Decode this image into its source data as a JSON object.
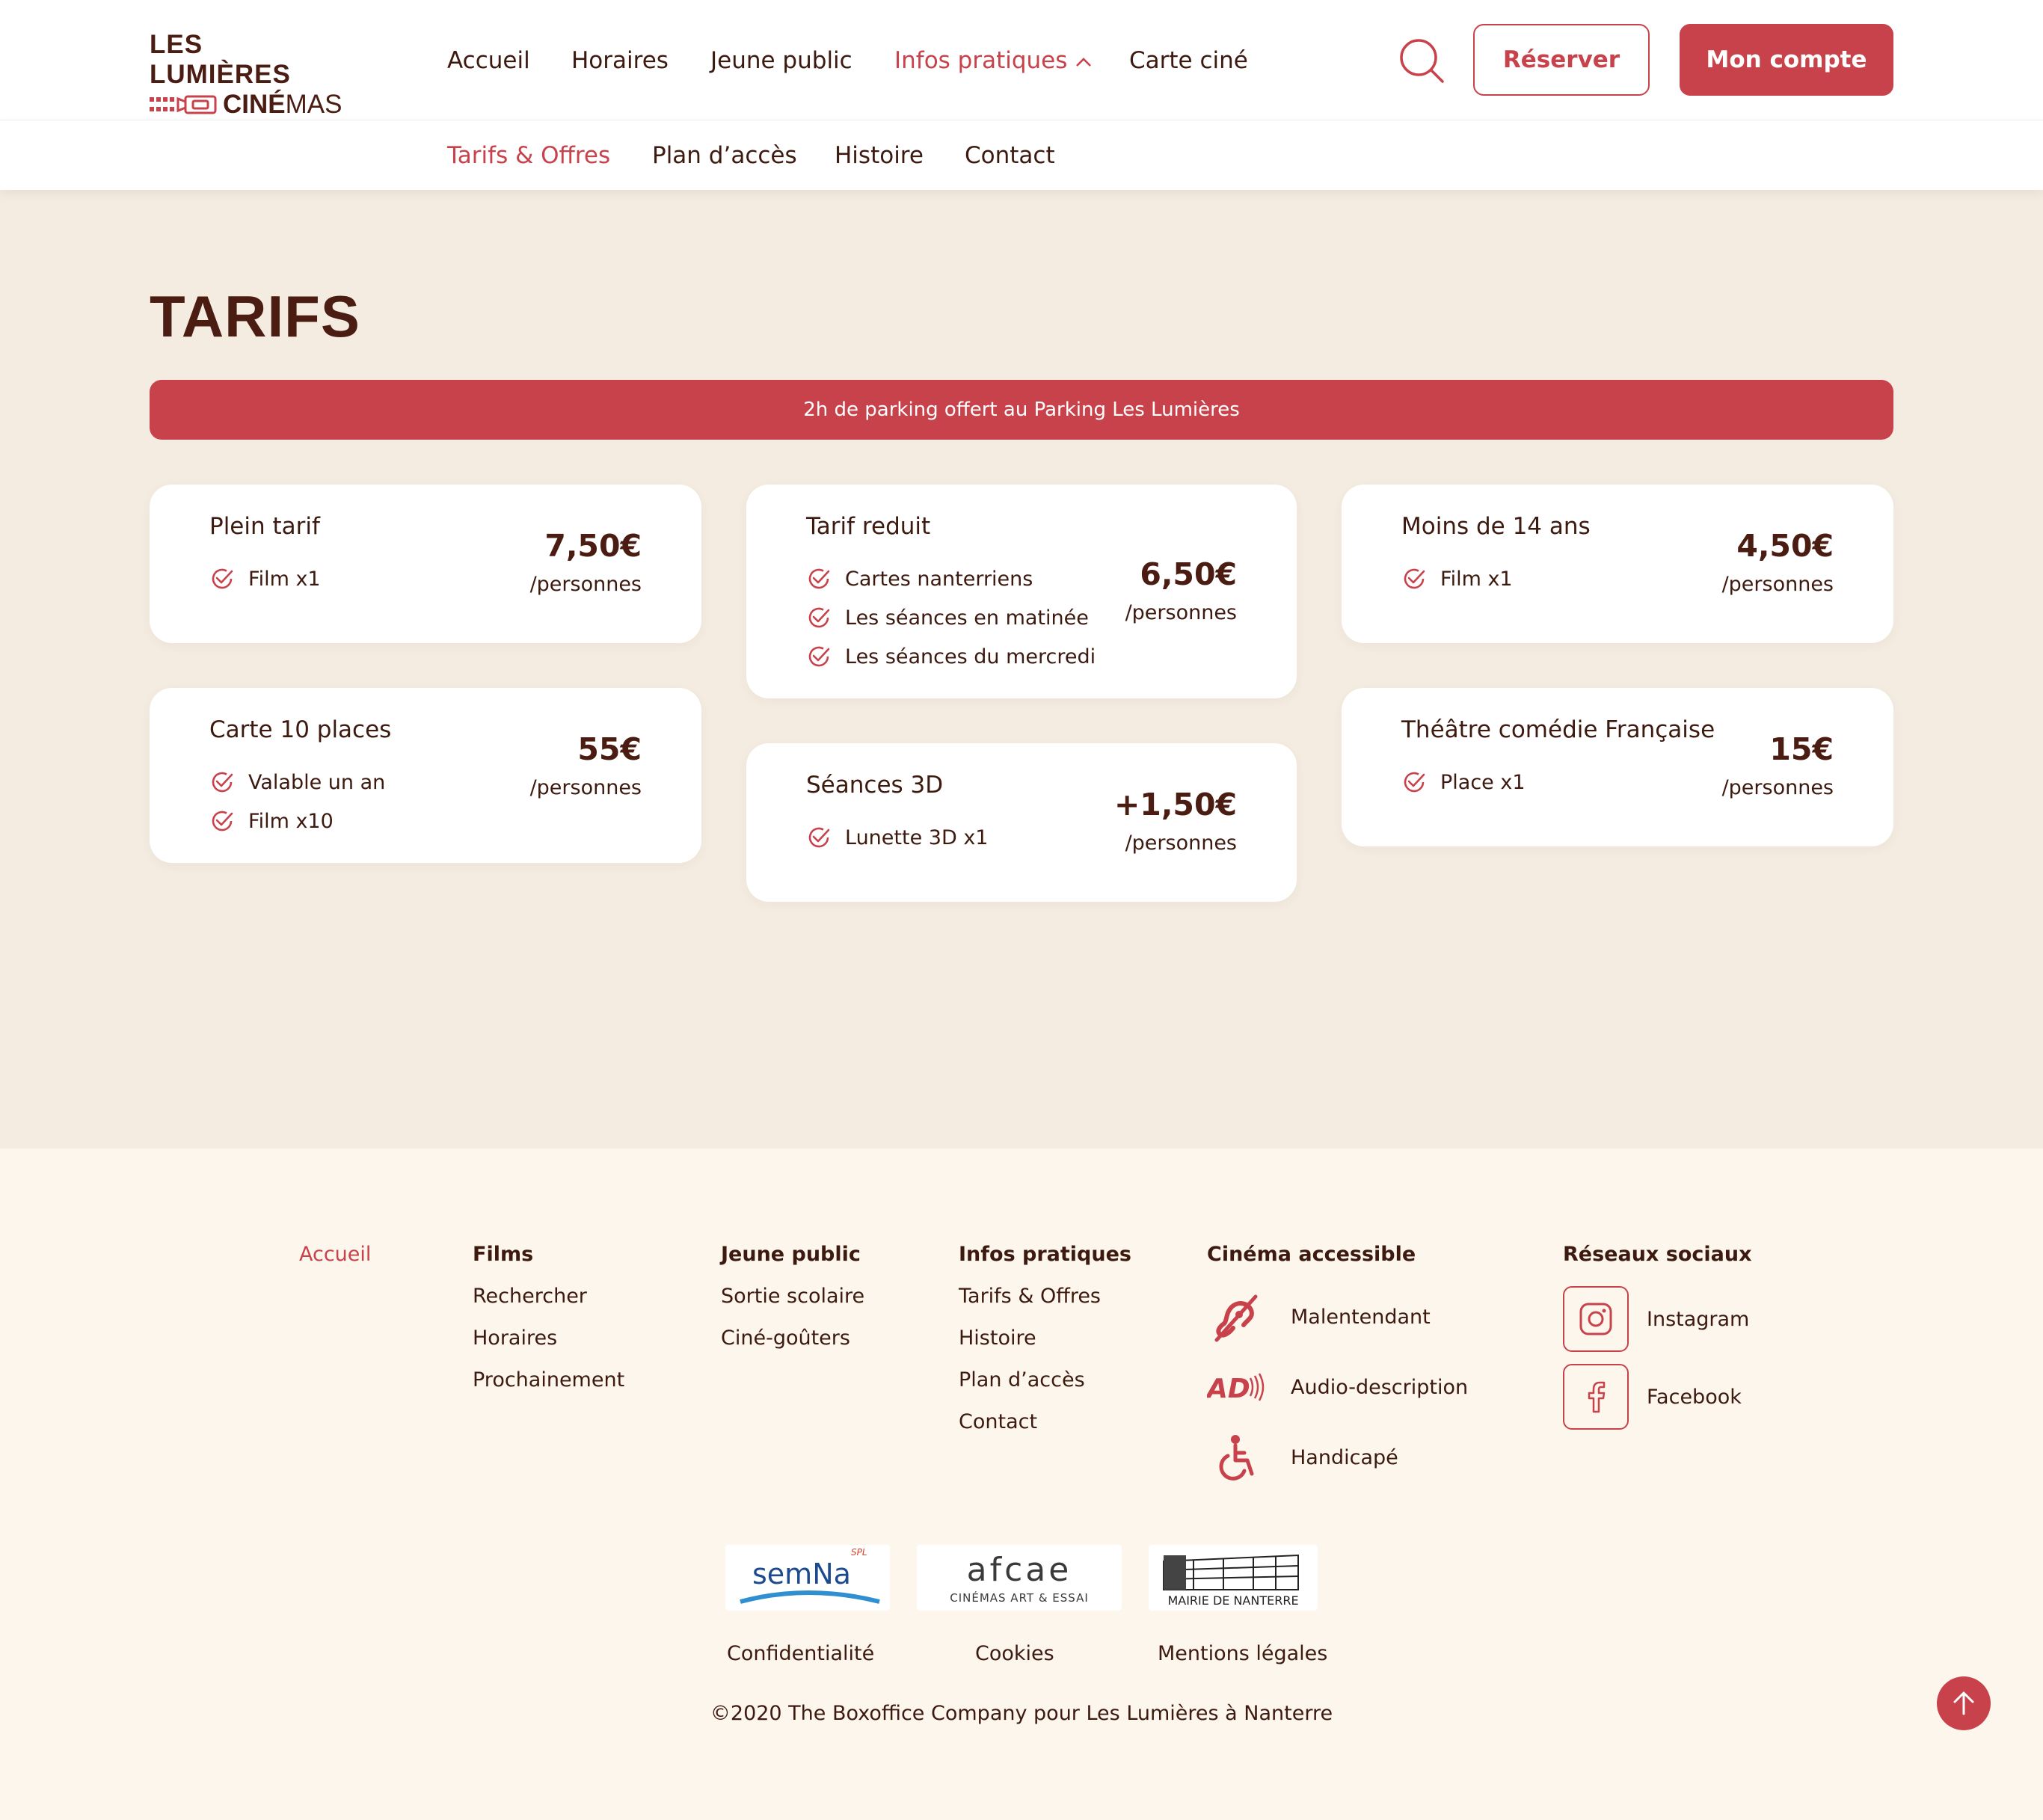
{
  "brand": {
    "line1": "LES LUMIÈRES",
    "line2_bold": "CINÉ",
    "line2_light": "MAS"
  },
  "nav": {
    "items": [
      "Accueil",
      "Horaires",
      "Jeune public",
      "Infos pratiques",
      "Carte ciné"
    ],
    "active": "Infos pratiques",
    "reserver_label": "Réserver",
    "compte_label": "Mon compte"
  },
  "subnav": {
    "items": [
      "Tarifs & Offres",
      "Plan d’accès",
      "Histoire",
      "Contact"
    ],
    "active": "Tarifs & Offres"
  },
  "page": {
    "title": "TARIFS",
    "banner": "2h de parking offert au Parking Les Lumières"
  },
  "cards": [
    {
      "title": "Plein tarif",
      "features": [
        "Film x1"
      ],
      "price": "7,50€",
      "per": "/personnes"
    },
    {
      "title": "Tarif reduit",
      "features": [
        "Cartes nanterriens",
        "Les séances en matinée",
        "Les séances du mercredi"
      ],
      "price": "6,50€",
      "per": "/personnes"
    },
    {
      "title": "Moins de 14 ans",
      "features": [
        "Film x1"
      ],
      "price": "4,50€",
      "per": "/personnes"
    },
    {
      "title": "Carte 10 places",
      "features": [
        "Valable un an",
        "Film x10"
      ],
      "price": "55€",
      "per": "/personnes"
    },
    {
      "title": "Séances 3D",
      "features": [
        "Lunette 3D x1"
      ],
      "price": "+1,50€",
      "per": "/personnes"
    },
    {
      "title": "Théâtre comédie Française",
      "features": [
        "Place x1"
      ],
      "price": "15€",
      "per": "/personnes"
    }
  ],
  "footer": {
    "accueil": "Accueil",
    "films": {
      "title": "Films",
      "links": [
        "Rechercher",
        "Horaires",
        "Prochainement"
      ]
    },
    "jeune": {
      "title": "Jeune public",
      "links": [
        "Sortie scolaire",
        "Ciné-goûters"
      ]
    },
    "infos": {
      "title": "Infos pratiques",
      "links": [
        "Tarifs & Offres",
        "Histoire",
        "Plan d’accès",
        "Contact"
      ]
    },
    "accessible": {
      "title": "Cinéma accessible",
      "items": [
        "Malentendant",
        "Audio-description",
        "Handicapé"
      ]
    },
    "social": {
      "title": "Réseaux sociaux",
      "items": [
        "Instagram",
        "Facebook"
      ]
    },
    "partners": {
      "semna": {
        "text": "semNa",
        "tag": "SPL"
      },
      "afcae": {
        "text": "afcae",
        "sub": "CINÉMAS ART & ESSAI"
      },
      "mairie": {
        "text": "MAIRIE DE NANTERRE"
      }
    },
    "legal": [
      "Confidentialité",
      "Cookies",
      "Mentions légales"
    ],
    "copyright": "©2020 The Boxoffice Company pour Les Lumières à Nanterre"
  },
  "colors": {
    "accent": "#c8424b",
    "dark": "#4a1c12",
    "bg": "#f4ece1",
    "footer_bg": "#fdf6ec"
  }
}
